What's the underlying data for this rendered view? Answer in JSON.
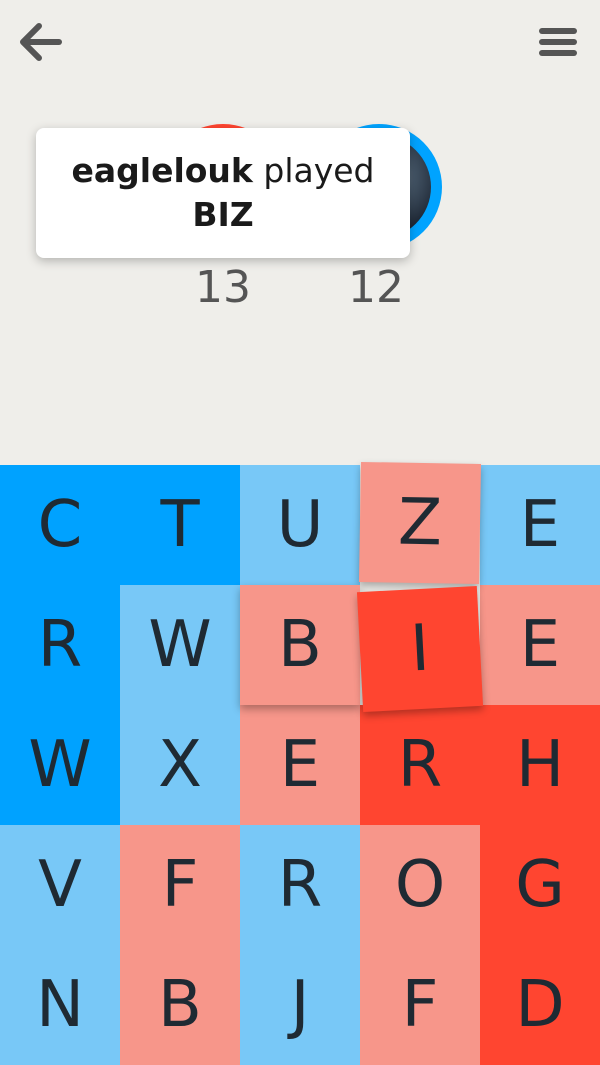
{
  "header": {
    "back_icon": "arrow-left-icon",
    "menu_icon": "hamburger-menu-icon"
  },
  "players": {
    "left": {
      "score": "13",
      "color": "#ff4530"
    },
    "right": {
      "score": "12",
      "color": "#00a3ff"
    }
  },
  "toast": {
    "player": "eaglelouk",
    "verb": "played",
    "word": "BIZ"
  },
  "colors": {
    "dark_blue": "#00a2ff",
    "light_blue": "#78c8f7",
    "light_red": "#f7968a",
    "dark_red": "#ff4530",
    "letter": "#1f2a33"
  },
  "board": {
    "rows": [
      [
        {
          "letter": "C",
          "color": "dark_blue"
        },
        {
          "letter": "T",
          "color": "dark_blue"
        },
        {
          "letter": "U",
          "color": "light_blue"
        },
        {
          "letter": "Z",
          "color": "light_red",
          "selected": true
        },
        {
          "letter": "E",
          "color": "light_blue"
        }
      ],
      [
        {
          "letter": "R",
          "color": "dark_blue"
        },
        {
          "letter": "W",
          "color": "light_blue"
        },
        {
          "letter": "B",
          "color": "light_red",
          "selected": true
        },
        {
          "letter": "I",
          "color": "dark_red",
          "selected": true
        },
        {
          "letter": "E",
          "color": "light_red"
        }
      ],
      [
        {
          "letter": "W",
          "color": "dark_blue"
        },
        {
          "letter": "X",
          "color": "light_blue"
        },
        {
          "letter": "E",
          "color": "light_red"
        },
        {
          "letter": "R",
          "color": "dark_red"
        },
        {
          "letter": "H",
          "color": "dark_red"
        }
      ],
      [
        {
          "letter": "V",
          "color": "light_blue"
        },
        {
          "letter": "F",
          "color": "light_red"
        },
        {
          "letter": "R",
          "color": "light_blue"
        },
        {
          "letter": "O",
          "color": "light_red"
        },
        {
          "letter": "G",
          "color": "dark_red"
        }
      ],
      [
        {
          "letter": "N",
          "color": "light_blue"
        },
        {
          "letter": "B",
          "color": "light_red"
        },
        {
          "letter": "J",
          "color": "light_blue"
        },
        {
          "letter": "F",
          "color": "light_red"
        },
        {
          "letter": "D",
          "color": "dark_red"
        }
      ]
    ]
  }
}
